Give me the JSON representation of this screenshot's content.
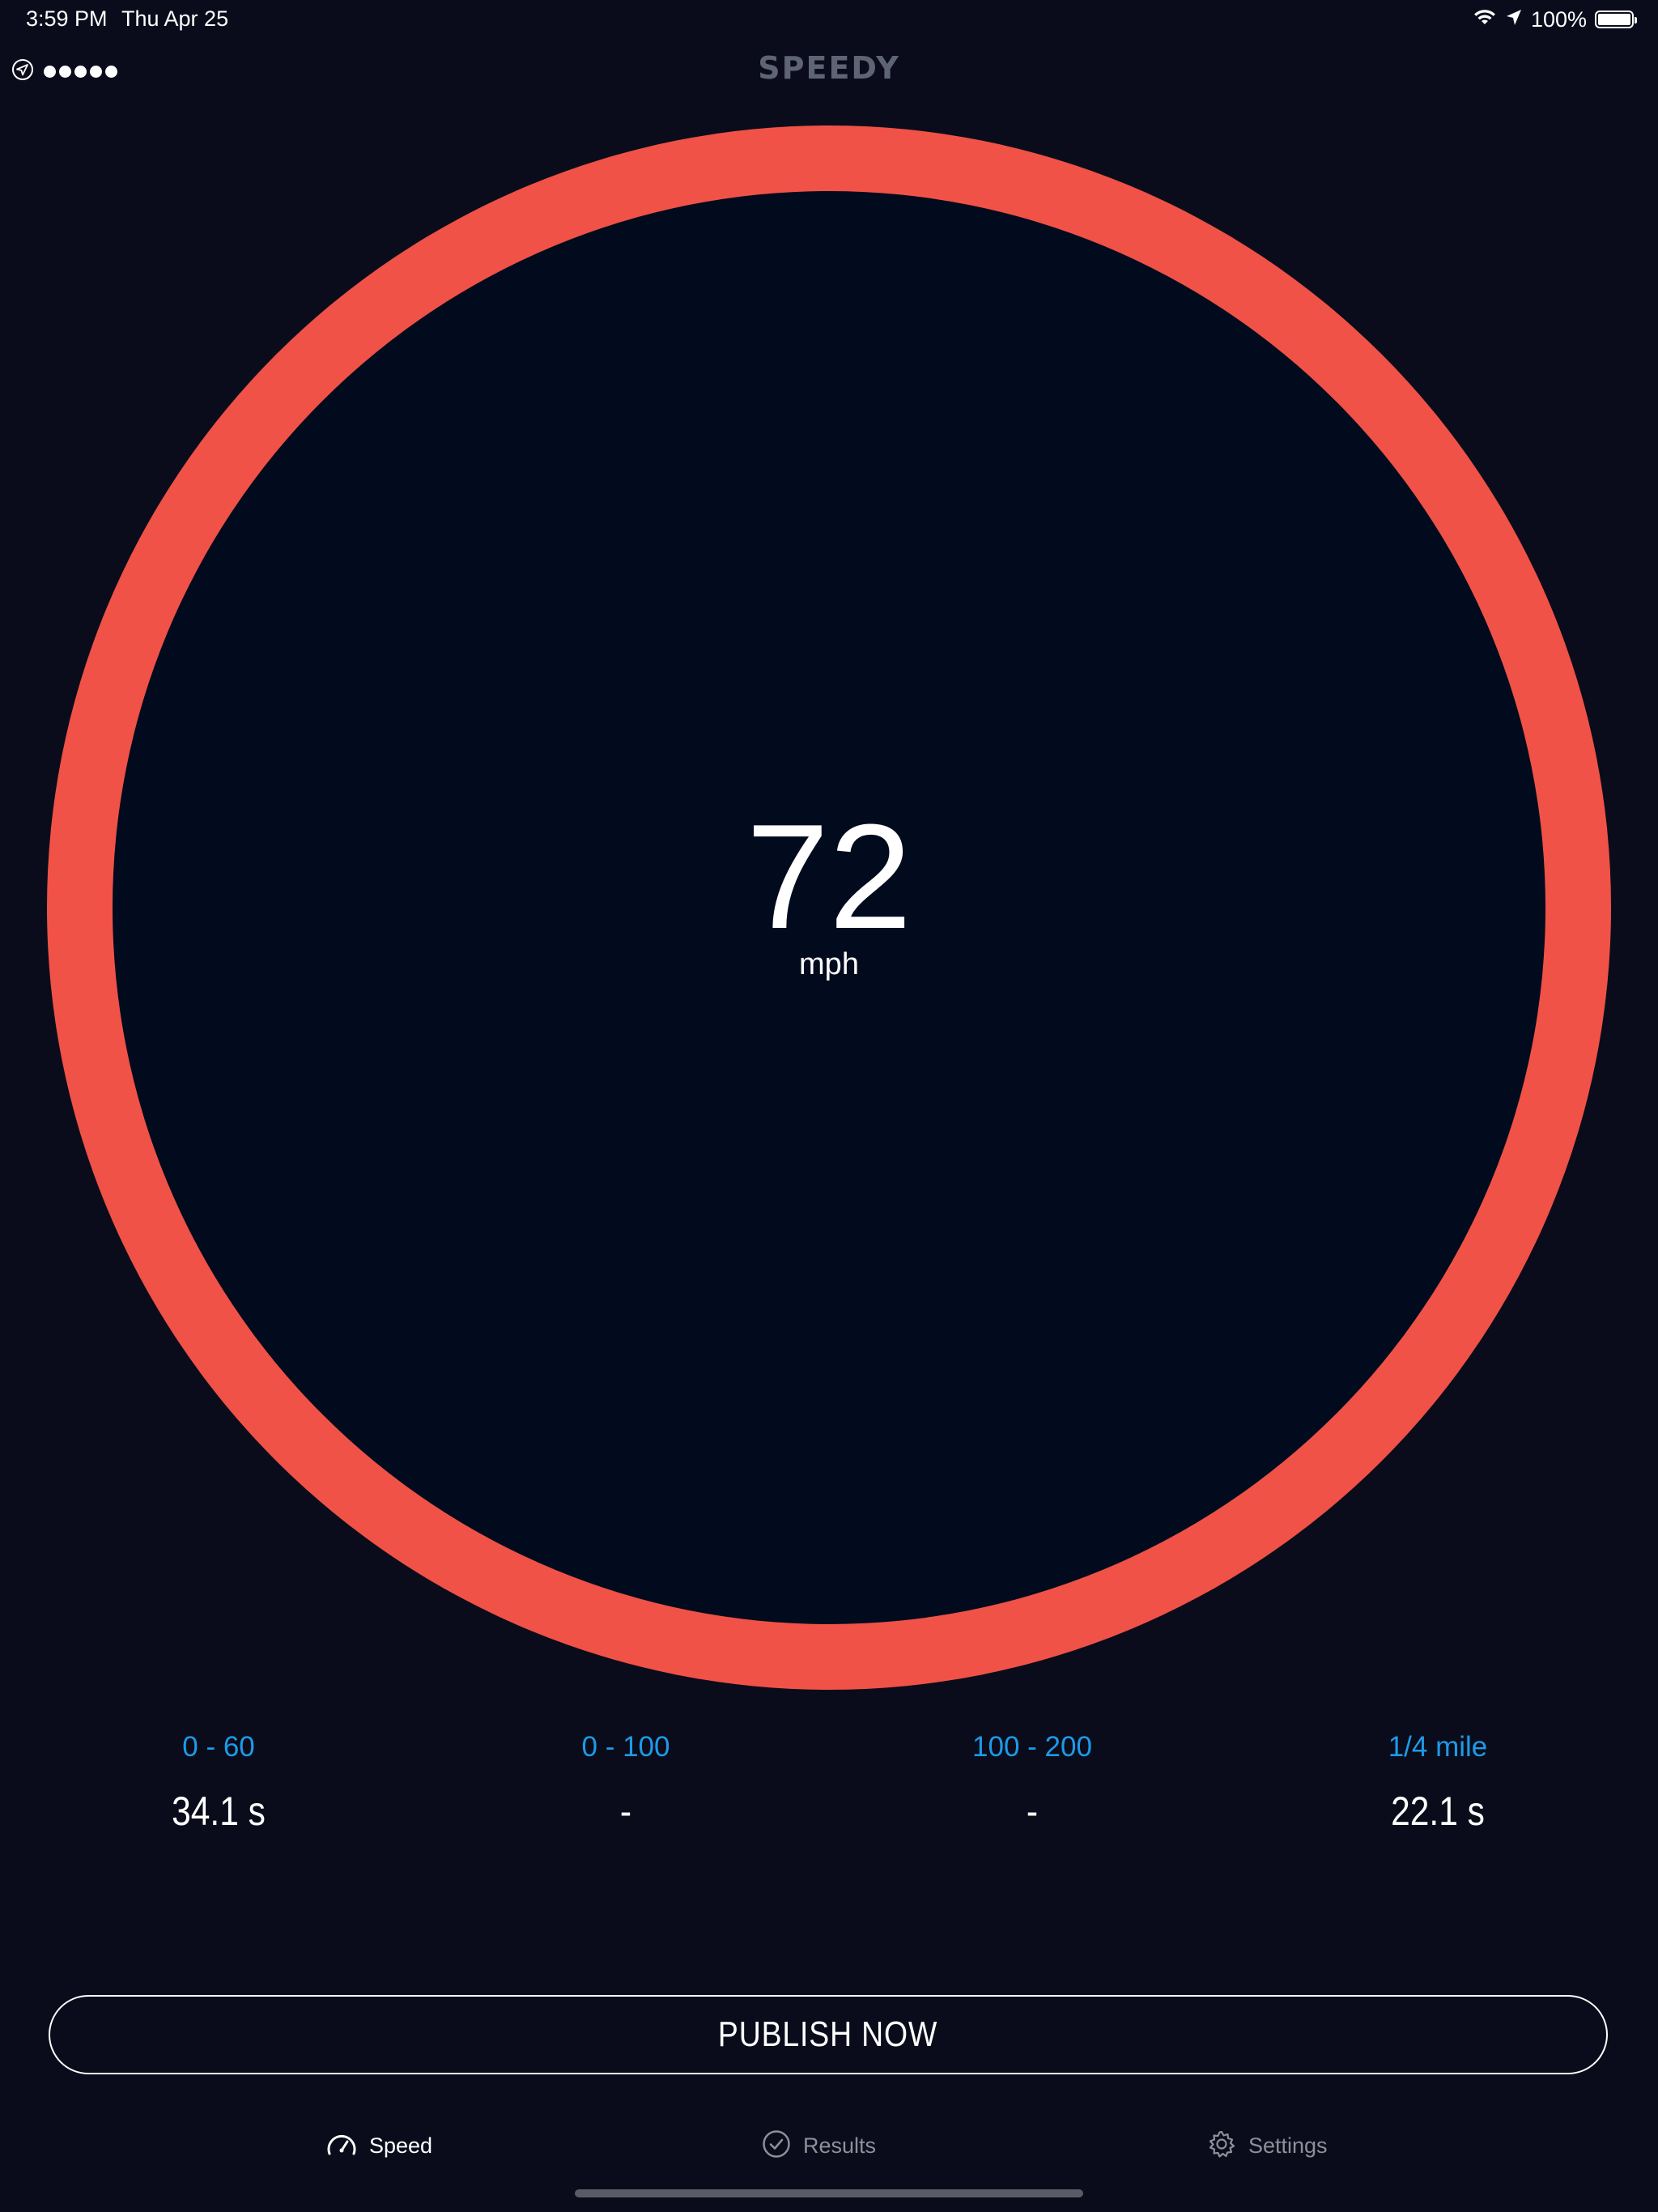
{
  "status_bar": {
    "time": "3:59 PM",
    "date": "Thu Apr 25",
    "battery": "100%",
    "icons": [
      "wifi-icon",
      "location-arrow-icon",
      "battery-icon"
    ]
  },
  "header": {
    "logo": "SPEEDY",
    "gps_icon": "location-arrow-icon",
    "gps_signal_dots": 5
  },
  "gauge": {
    "speed": "72",
    "unit": "mph",
    "ring_color": "#f05247",
    "inner_color": "#020b1e"
  },
  "stats": [
    {
      "label": "0 - 60",
      "value": "34.1 s"
    },
    {
      "label": "0 - 100",
      "value": "-"
    },
    {
      "label": "100 - 200",
      "value": "-"
    },
    {
      "label": "1/4 mile",
      "value": "22.1 s"
    }
  ],
  "publish_button": {
    "label": "PUBLISH NOW"
  },
  "tabs": [
    {
      "label": "Speed",
      "icon": "speedometer-icon",
      "active": true
    },
    {
      "label": "Results",
      "icon": "checkmark-circle-icon",
      "active": false
    },
    {
      "label": "Settings",
      "icon": "gear-icon",
      "active": false
    }
  ],
  "colors": {
    "background": "#0b0c1b",
    "accent": "#1c9be8",
    "ring": "#f05247"
  }
}
